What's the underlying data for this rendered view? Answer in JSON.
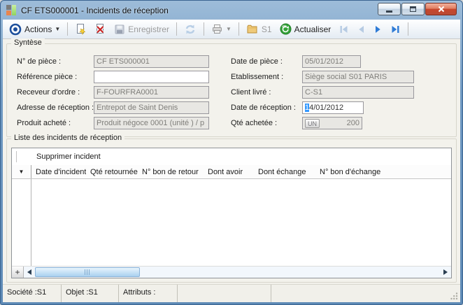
{
  "window": {
    "title": "CF ETS000001 - Incidents de réception",
    "icon": "app-squares-icon",
    "controls": {
      "minimize": "minimize",
      "maximize": "maximize",
      "close": "close"
    }
  },
  "toolbar": {
    "actions_label": "Actions",
    "save_label": "Enregistrer",
    "folder_label": "S1",
    "refresh_label": "Actualiser",
    "icons": [
      "bullseye-icon",
      "new-document-icon",
      "delete-document-icon",
      "save-icon",
      "sync-icon",
      "printer-icon",
      "folder-icon",
      "refresh-green-icon",
      "nav-first-icon",
      "nav-previous-icon",
      "nav-next-icon",
      "nav-last-icon"
    ]
  },
  "synthesis": {
    "title": "Syntèse",
    "left": [
      {
        "label": "N° de pièce :",
        "value": "CF ETS000001"
      },
      {
        "label": "Référence pièce :",
        "value": ""
      },
      {
        "label": "Receveur d'ordre :",
        "value": "F-FOURFRA0001"
      },
      {
        "label": "Adresse de réception :",
        "value": "Entrepot de Saint Denis"
      },
      {
        "label": "Produit acheté :",
        "value": "Produit négoce 0001 (unité ) / p"
      }
    ],
    "right": [
      {
        "label": "Date de pièce :",
        "value": "05/01/2012"
      },
      {
        "label": "Etablissement :",
        "value": "Siège social S01 PARIS"
      },
      {
        "label": "Client livré :",
        "value": "C-S1"
      },
      {
        "label": "Date de réception :",
        "value_selected": "1",
        "value_rest": "4/01/2012"
      },
      {
        "label": "Qté achetée :",
        "unit": "UN",
        "value": "200"
      }
    ]
  },
  "incidents": {
    "title": "Liste des incidents de réception",
    "delete_button": "Supprimer incident",
    "columns": [
      "Date d'incident",
      "Qté retournée",
      "N° bon de retour",
      "Dont avoir",
      "Dont échange",
      "N° bon d'échange"
    ],
    "rows": []
  },
  "statusbar": {
    "cells": [
      "Société :S1",
      "Objet :S1",
      "Attributs :",
      "",
      ""
    ]
  },
  "colors": {
    "frame_blue": "#6f99c2",
    "accent_blue": "#2e7bd6",
    "disabled_blue": "#b6cbe3",
    "selection": "#3399ff",
    "disabled_field_bg": "#e8e7e3",
    "client_bg": "#f3f2ec",
    "green_refresh": "#35a33a"
  }
}
